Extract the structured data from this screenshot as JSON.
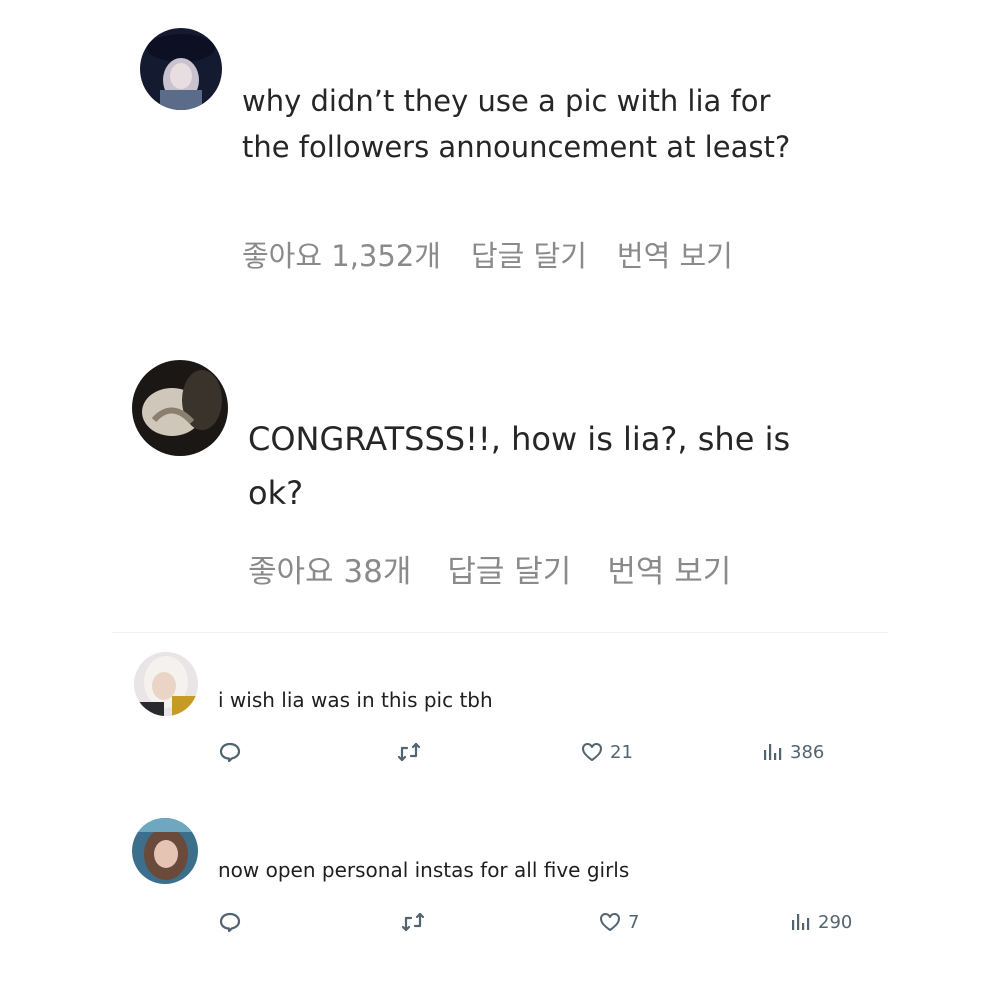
{
  "instagram_comments": [
    {
      "text": "why didn’t they use a pic with lia for the followers announcement at least?",
      "likes_label": "좋아요 1,352개",
      "reply_label": "답글 달기",
      "translate_label": "번역 보기"
    },
    {
      "text": "CONGRATSSS!!, how is lia?, she is ok?",
      "likes_label": "좋아요 38개",
      "reply_label": "답글 달기",
      "translate_label": "번역 보기"
    }
  ],
  "twitter_replies": [
    {
      "text": "i wish lia was in this pic tbh",
      "like_count": "21",
      "view_count": "386"
    },
    {
      "text": "now open personal instas for all five girls",
      "like_count": "7",
      "view_count": "290"
    }
  ],
  "icons": {
    "reply": "speech-bubble-icon",
    "retweet": "retweet-arrows-icon",
    "like": "heart-outline-icon",
    "views": "bar-chart-icon"
  },
  "colors": {
    "twitter_icon_gray": "#536471",
    "instagram_meta_gray": "#8a8a8a"
  }
}
